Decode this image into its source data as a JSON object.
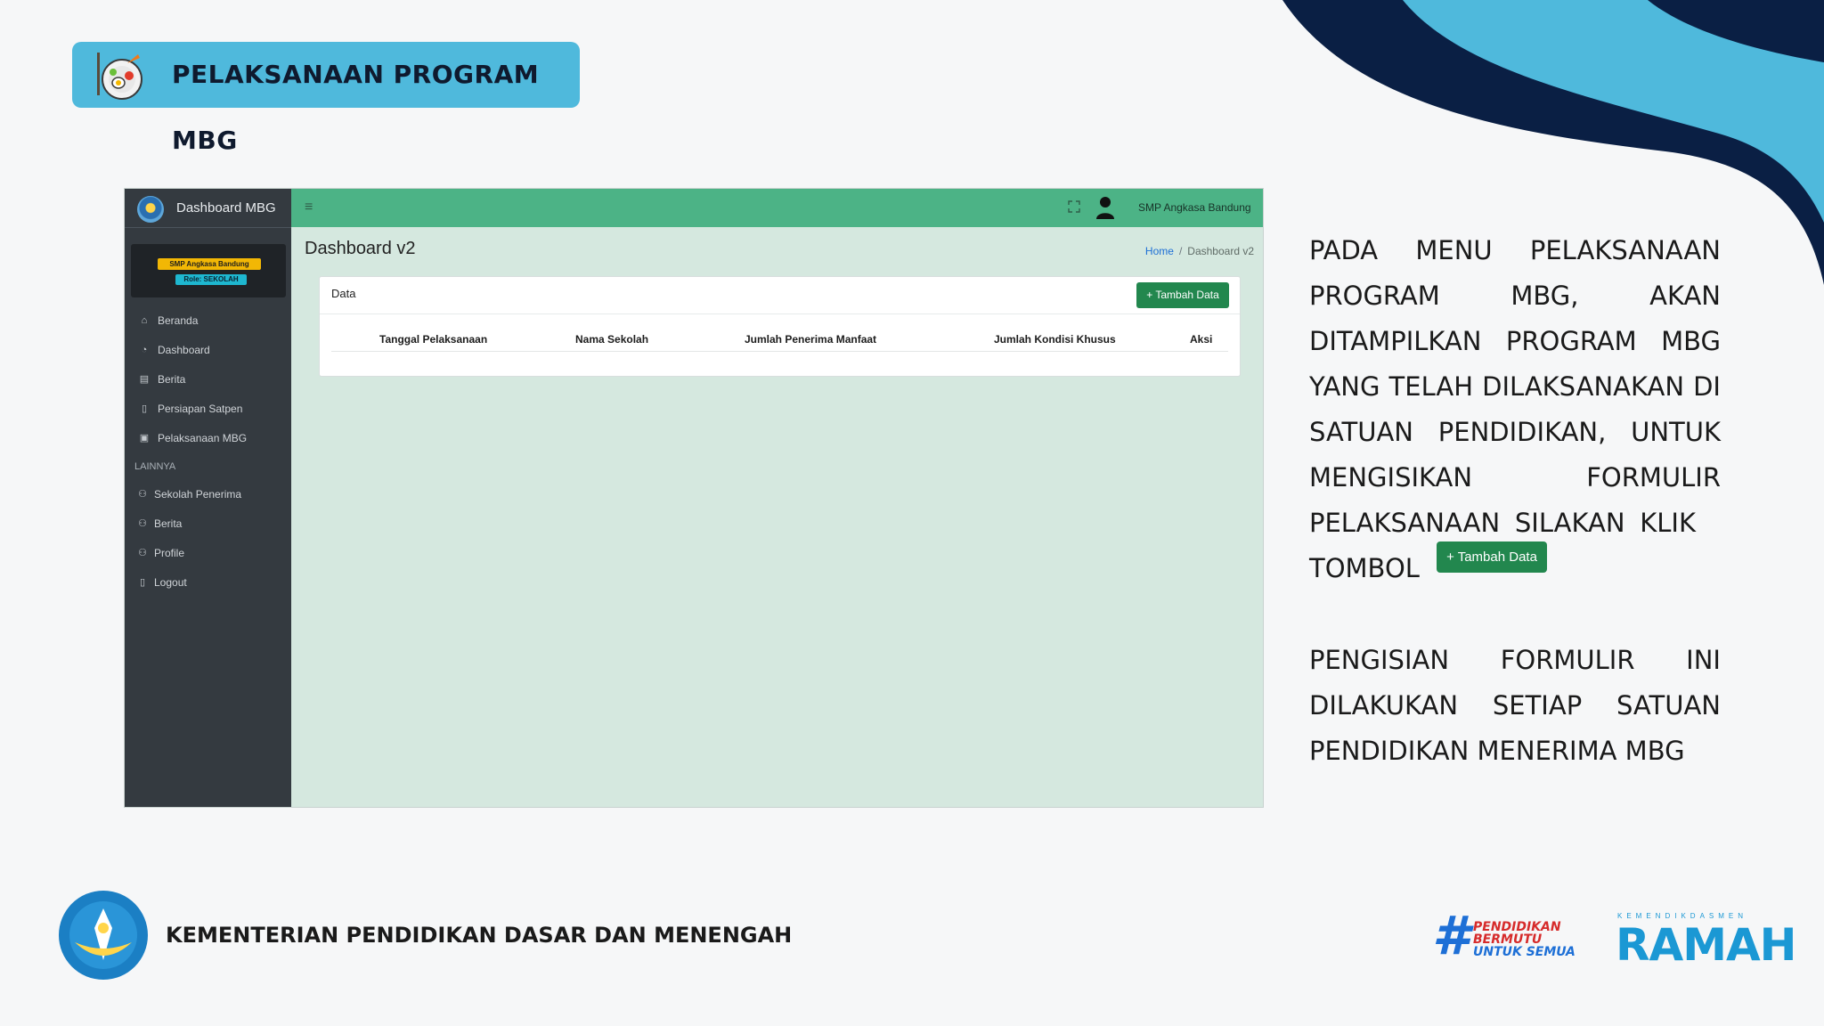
{
  "slide": {
    "title": "PELAKSANAAN PROGRAM MBG",
    "ministry_name": "KEMENTERIAN PENDIDIKAN DASAR DAN MENENGAH",
    "hashtag_logo_lines": [
      "PENDIDIKAN",
      "BERMUTU",
      "UNTUK SEMUA"
    ],
    "ramah_small": "KEMENDIKDASMEN",
    "ramah_big": "RAMAH",
    "paragraph1_lines": [
      [
        "PADA",
        "MENU",
        "PELAKSANAAN"
      ],
      [
        "PROGRAM",
        "MBG,",
        "AKAN"
      ],
      [
        "DITAMPILKAN",
        "PROGRAM",
        "MBG"
      ],
      [
        "YANG",
        "TELAH",
        "DILAKSANAKAN",
        "DI"
      ],
      [
        "SATUAN",
        "PENDIDIKAN,",
        "UNTUK"
      ],
      [
        "MENGISIKAN",
        "FORMULIR"
      ],
      [
        "PELAKSANAAN",
        "SILAKAN",
        "KLIK"
      ],
      [
        "TOMBOL"
      ]
    ],
    "inline_button": "+ Tambah Data",
    "paragraph2_lines": [
      [
        "PENGISIAN",
        "FORMULIR",
        "INI"
      ],
      [
        "DILAKUKAN",
        "SETIAP",
        "SATUAN"
      ],
      [
        "PENDIDIKAN MENERIMA MBG"
      ]
    ]
  },
  "app": {
    "brand": "Dashboard MBG",
    "user_school": "SMP Angkasa Bandung",
    "user_role": "Role: SEKOLAH",
    "nav": [
      "Beranda",
      "Dashboard",
      "Berita",
      "Persiapan Satpen",
      "Pelaksanaan MBG"
    ],
    "section_header": "LAINNYA",
    "nav_other": [
      "Sekolah Penerima",
      "Berita",
      "Profile",
      "Logout"
    ],
    "top_user": "SMP Angkasa Bandung",
    "page_title": "Dashboard v2",
    "breadcrumb_home": "Home",
    "breadcrumb_current": "Dashboard v2",
    "card_title": "Data",
    "add_button": "+ Tambah Data",
    "columns": [
      "Tanggal Pelaksanaan",
      "Nama Sekolah",
      "Jumlah Penerima Manfaat",
      "Jumlah Kondisi Khusus",
      "Aksi"
    ]
  },
  "colors": {
    "accent": "#4fb9dc",
    "navy": "#0a1f44",
    "topbar": "#4cb386",
    "button": "#22874e"
  }
}
